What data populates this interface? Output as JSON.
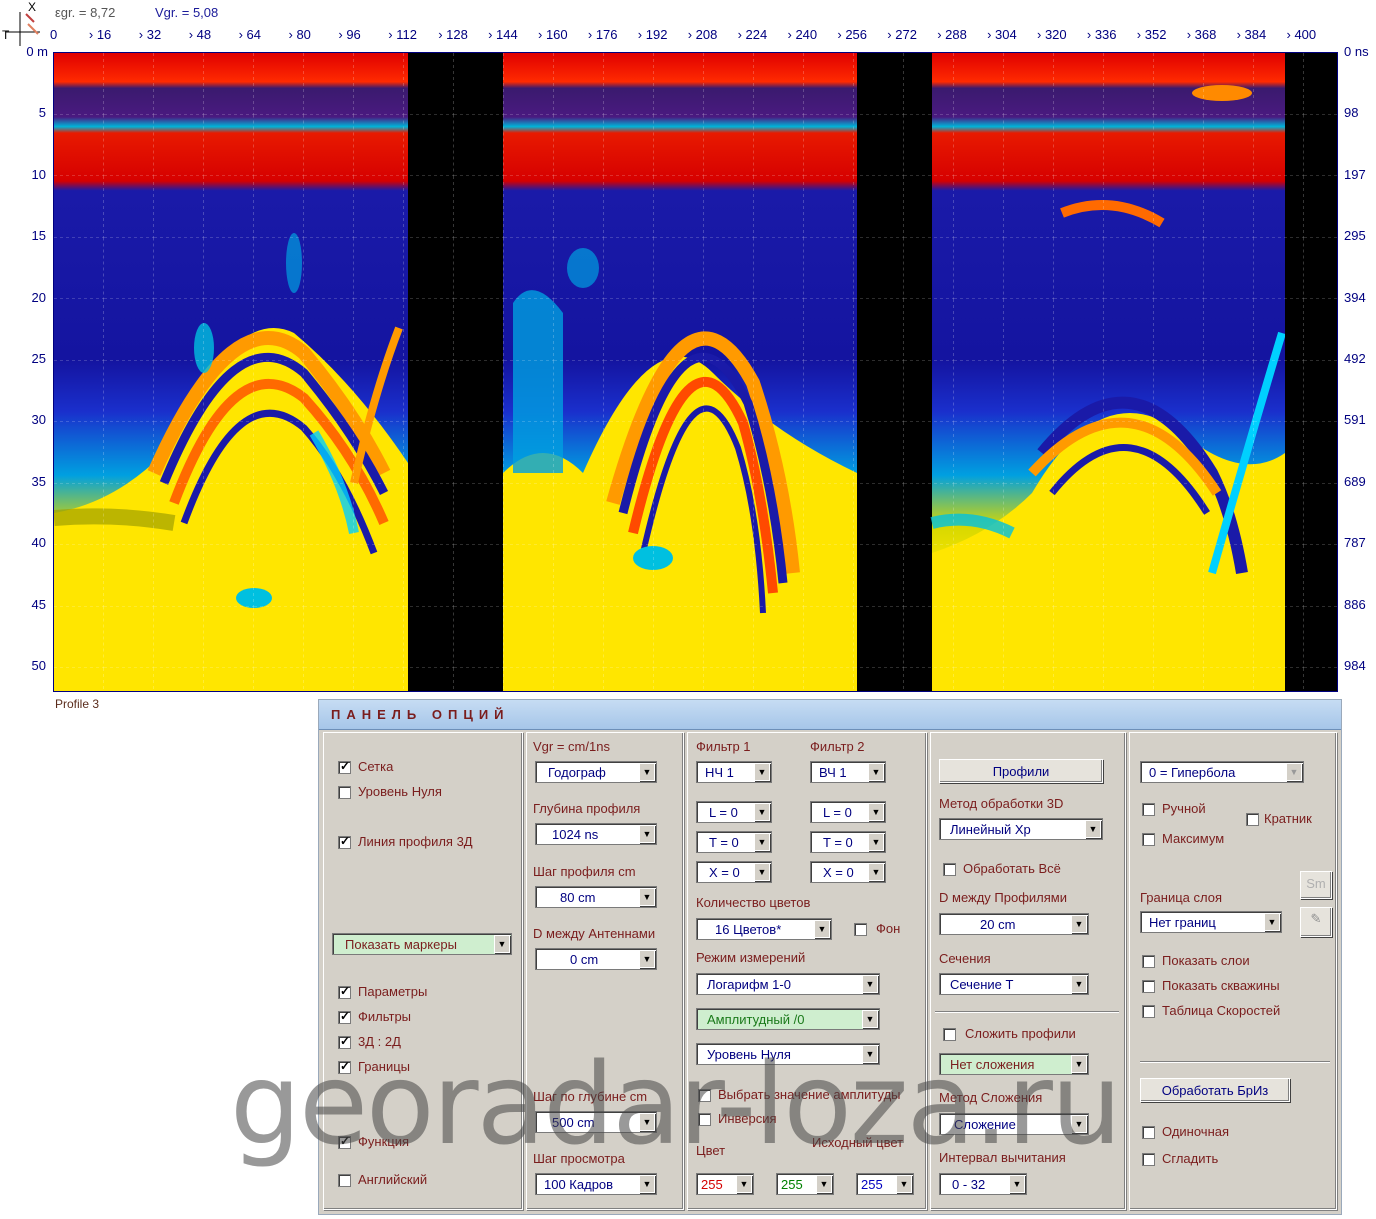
{
  "header": {
    "egr": "εgr. = 8,72",
    "vgr": "Vgr. = 5,08",
    "axis_t": "T",
    "axis_x": "X"
  },
  "top_ticks": [
    "0",
    "16",
    "32",
    "48",
    "64",
    "80",
    "96",
    "112",
    "128",
    "144",
    "160",
    "176",
    "192",
    "208",
    "224",
    "240",
    "256",
    "272",
    "288",
    "304",
    "320",
    "336",
    "352",
    "368",
    "384",
    "400"
  ],
  "depth_ticks": [
    "0 m",
    "5",
    "10",
    "15",
    "20",
    "25",
    "30",
    "35",
    "40",
    "45",
    "50"
  ],
  "ns_ticks": [
    "0 ns",
    "98",
    "197",
    "295",
    "394",
    "492",
    "591",
    "689",
    "787",
    "886",
    "984"
  ],
  "profile_label": "Profile 3",
  "panel": {
    "title": "ПАНЕЛЬ ОПЦИЙ",
    "col1": {
      "grid": "Сетка",
      "zero_level": "Уровень Нуля",
      "profile_line_3d": "Линия профиля 3Д",
      "markers": "Показать маркеры",
      "params": "Параметры",
      "filters": "Фильтры",
      "mode_3d2d": "3Д : 2Д",
      "borders": "Границы",
      "function": "Функция",
      "english": "Английский"
    },
    "col2": {
      "vgr_label": "Vgr = cm/1ns",
      "hodograph": "Годограф",
      "depth_label": "Глубина профиля",
      "depth_value": "1024  ns",
      "step_label": "Шаг профиля cm",
      "step_value": "80 cm",
      "antenna_label": "D между Антеннами",
      "antenna_value": "0 cm",
      "depth_step_label": "Шаг по глубине cm",
      "depth_step_value": "500 cm",
      "view_step_label": "Шаг просмотра",
      "view_step_value": "100 Кадров"
    },
    "col3": {
      "filter1": "Фильтр 1",
      "filter1_value": "НЧ 1",
      "filter2": "Фильтр 2",
      "filter2_value": "ВЧ 1",
      "l1": "L = 0",
      "t1": "T = 0",
      "x1": "X = 0",
      "l2": "L = 0",
      "t2": "T = 0",
      "x2": "X = 0",
      "colors_label": "Количество цветов",
      "colors_value": "16 Цветов*",
      "background": "Фон",
      "mode_label": "Режим измерений",
      "mode_value": "Логарифм 1-0",
      "amplitude": "Амплитудный /0",
      "zero_level": "Уровень Нуля",
      "select_amp": "Выбрать значение амплитуды",
      "inversion": "Инверсия",
      "color_label": "Цвет",
      "source_color": "Исходный цвет",
      "r": "255",
      "g": "255",
      "b": "255",
      "colors": {
        "r": "#d40000",
        "g": "#008000",
        "b": "#0000c0"
      }
    },
    "col4": {
      "profiles_btn": "Профили",
      "method3d_label": "Метод обработки 3D",
      "method3d_value": "Линейный Хр",
      "process_all": "Обработать Всё",
      "dist_label": "D между Профилями",
      "dist_value": "20 cm",
      "sections_label": "Сечения",
      "section_value": "Сечение T",
      "sum_profiles": "Сложить профили",
      "no_sum": "Нет сложения",
      "sum_method_label": "Метод Сложения",
      "sum_method_value": "Сложение",
      "subtract_label": "Интервал вычитания",
      "subtract_value": "0 - 32"
    },
    "col5": {
      "hyperbola": "0 = Гипербола",
      "manual": "Ручной",
      "multiple": "Кратник",
      "maximum": "Максимум",
      "sm_btn": "Sm",
      "layer_border_label": "Граница слоя",
      "layer_border_value": "Нет границ",
      "show_layers": "Показать слои",
      "show_wells": "Показать скважины",
      "speed_table": "Таблица Скоростей",
      "process_bris": "Обработать БрИз",
      "single": "Одиночная",
      "smooth": "Сгладить"
    }
  },
  "watermark": "georadar-loza.ru",
  "colors": {
    "accent": "#7a1d1d",
    "tick": "#000080",
    "panel_bg": "#d4d0c8",
    "title_bg": "#a6c6e9"
  }
}
